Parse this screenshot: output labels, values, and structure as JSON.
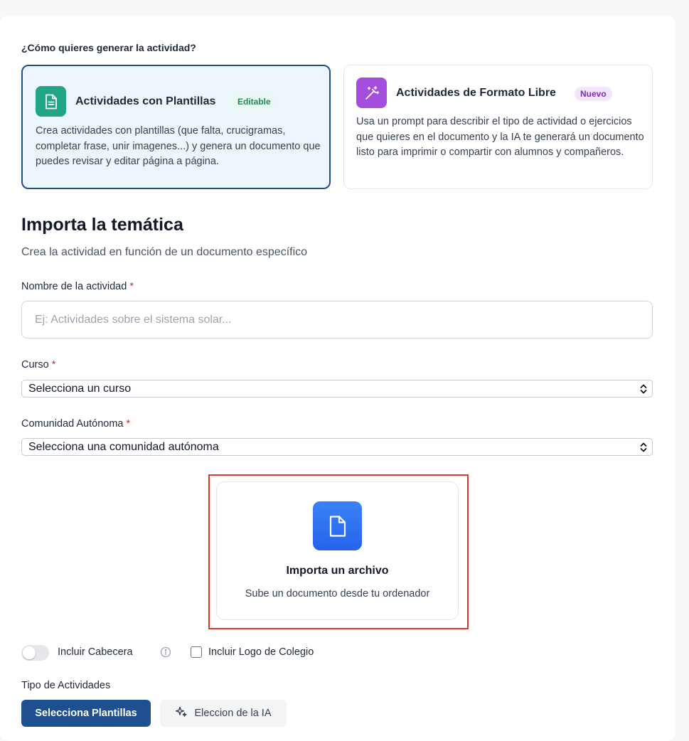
{
  "generation": {
    "question": "¿Cómo quieres generar la actividad?",
    "options": [
      {
        "title": "Actividades con Plantillas",
        "badge": "Editable",
        "icon": "document-text-icon",
        "description": "Crea actividades con plantillas (que falta, crucigramas, completar frase, unir imagenes...) y genera un documento que puedes revisar y editar página a página.",
        "selected": true,
        "icon_color": "#21a586"
      },
      {
        "title": "Actividades de Formato Libre",
        "badge": "Nuevo",
        "icon": "magic-wand-icon",
        "description": "Usa un prompt para describir el tipo de actividad o ejercicios que quieres en el documento y la IA te generará un documento listo para imprimir o compartir con alumnos y compañeros.",
        "selected": false,
        "icon_color": "#a44ddf"
      }
    ]
  },
  "import_section": {
    "title": "Importa la temática",
    "subtitle": "Crea la actividad en función de un documento específico"
  },
  "form": {
    "name_label": "Nombre de la actividad",
    "name_placeholder": "Ej: Actividades sobre el sistema solar...",
    "name_value": "",
    "course_label": "Curso",
    "course_value": "Selecciona un curso",
    "community_label": "Comunidad Autónoma",
    "community_value": "Selecciona una comunidad autónoma",
    "required_marker": "*"
  },
  "upload": {
    "title": "Importa un archivo",
    "subtitle": "Sube un documento desde tu ordenador",
    "icon": "file-icon"
  },
  "options": {
    "include_header_label": "Incluir Cabecera",
    "include_header_on": false,
    "include_logo_label": "Incluir Logo de Colegio",
    "include_logo_checked": false
  },
  "activity_type": {
    "label": "Tipo de Actividades",
    "primary_button": "Selecciona Plantillas",
    "secondary_button": "Eleccion de la IA"
  },
  "colors": {
    "primary": "#1e4f8f",
    "highlight_frame": "#e0392b",
    "upload_icon_bg": "#2563eb"
  }
}
